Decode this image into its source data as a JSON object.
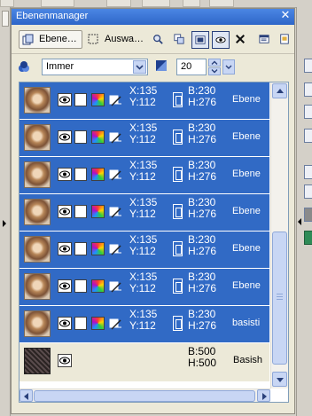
{
  "palette": {
    "title": "Ebenenmanager",
    "close_icon": "close-icon"
  },
  "toolbar": {
    "tab_layers": "Ebene…",
    "tab_selection": "Auswa…",
    "icons": [
      "zoom-layer-icon",
      "copy-layer-icon",
      "visibility-icon",
      "eye-toggle-icon",
      "delete-x-icon",
      "properties-icon",
      "print-icon"
    ]
  },
  "options": {
    "blend_mode": "Immer",
    "opacity": "20"
  },
  "layers": [
    {
      "x": "X:135",
      "y": "Y:112",
      "b": "B:230",
      "h": "H:276",
      "name": "Ebene",
      "selected": true
    },
    {
      "x": "X:135",
      "y": "Y:112",
      "b": "B:230",
      "h": "H:276",
      "name": "Ebene",
      "selected": true
    },
    {
      "x": "X:135",
      "y": "Y:112",
      "b": "B:230",
      "h": "H:276",
      "name": "Ebene",
      "selected": true
    },
    {
      "x": "X:135",
      "y": "Y:112",
      "b": "B:230",
      "h": "H:276",
      "name": "Ebene",
      "selected": true
    },
    {
      "x": "X:135",
      "y": "Y:112",
      "b": "B:230",
      "h": "H:276",
      "name": "Ebene",
      "selected": true
    },
    {
      "x": "X:135",
      "y": "Y:112",
      "b": "B:230",
      "h": "H:276",
      "name": "Ebene",
      "selected": true
    },
    {
      "x": "X:135",
      "y": "Y:112",
      "b": "B:230",
      "h": "H:276",
      "name": "basisti",
      "selected": true
    }
  ],
  "base_layer": {
    "b": "B:500",
    "h": "H:500",
    "name": "Basish"
  },
  "colors": {
    "selection": "#316ac5",
    "titlebar": "#2e66c8",
    "panel": "#ece9d8"
  }
}
